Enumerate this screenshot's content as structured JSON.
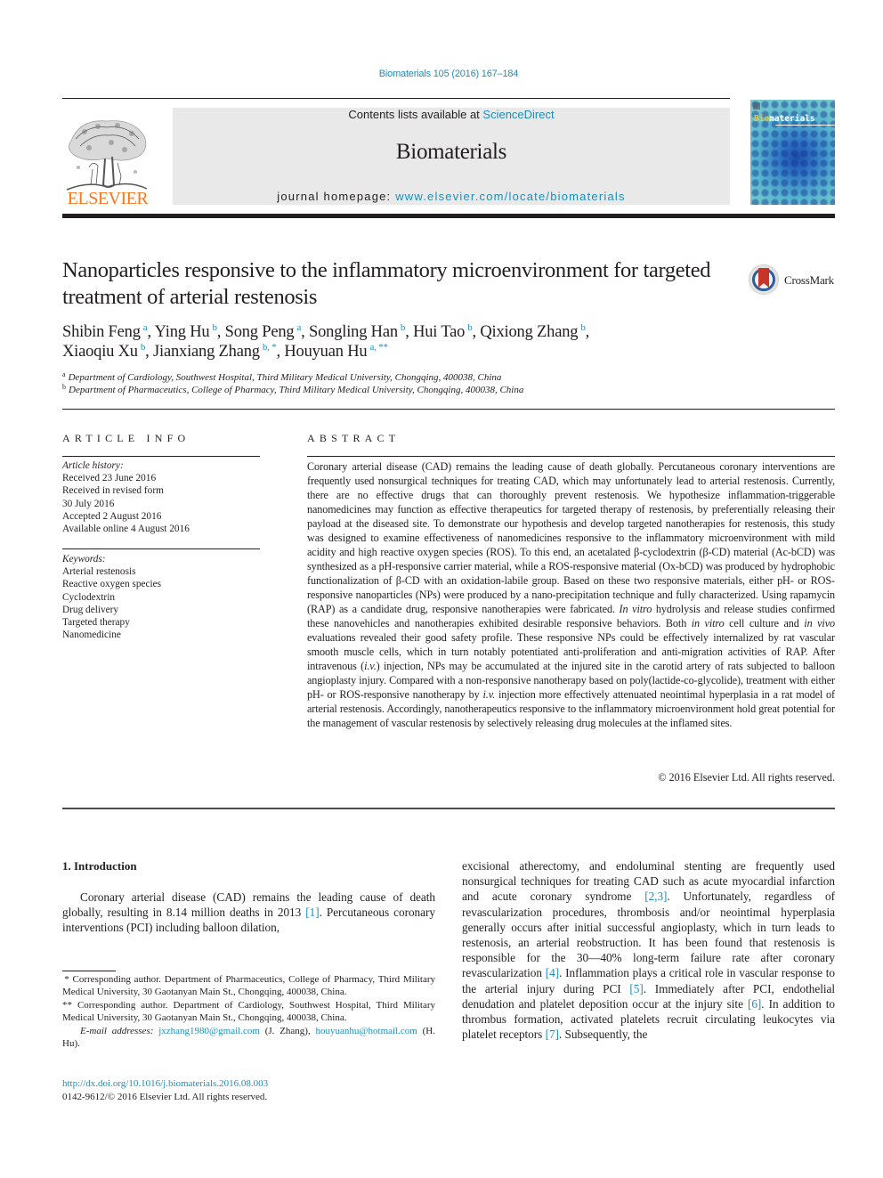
{
  "header": {
    "citation": "Biomaterials 105 (2016) 167–184",
    "contents_prefix": "Contents lists available at ",
    "contents_link": "ScienceDirect",
    "journal_name": "Biomaterials",
    "homepage_prefix": "journal homepage: ",
    "homepage_link": "www.elsevier.com/locate/biomaterials",
    "publisher_logo_text": "ELSEVIER",
    "cover_title_highlight": "Bio",
    "cover_title_rest": "materials",
    "crossmark_label": "CrossMark"
  },
  "article": {
    "title": "Nanoparticles responsive to the inflammatory microenvironment for targeted treatment of arterial restenosis",
    "authors": [
      {
        "name": "Shibin Feng",
        "aff": "a",
        "sep": ", "
      },
      {
        "name": "Ying Hu",
        "aff": "b",
        "sep": ", "
      },
      {
        "name": "Song Peng",
        "aff": "a",
        "sep": ", "
      },
      {
        "name": "Songling Han",
        "aff": "b",
        "sep": ", "
      },
      {
        "name": "Hui Tao",
        "aff": "b",
        "sep": ", "
      },
      {
        "name": "Qixiong Zhang",
        "aff": "b",
        "sep": ","
      },
      {
        "name": "Xiaoqiu Xu",
        "aff": "b",
        "sep": ", "
      },
      {
        "name": "Jianxiang Zhang",
        "aff": "b, *",
        "sep": ", "
      },
      {
        "name": "Houyuan Hu",
        "aff": "a, **",
        "sep": ""
      }
    ],
    "affiliations": [
      {
        "key": "a",
        "text": "Department of Cardiology, Southwest Hospital, Third Military Medical University, Chongqing, 400038, China"
      },
      {
        "key": "b",
        "text": "Department of Pharmaceutics, College of Pharmacy, Third Military Medical University, Chongqing, 400038, China"
      }
    ]
  },
  "article_info": {
    "heading": "ARTICLE INFO",
    "history_label": "Article history:",
    "history": [
      "Received 23 June 2016",
      "Received in revised form",
      "30 July 2016",
      "Accepted 2 August 2016",
      "Available online 4 August 2016"
    ],
    "keywords_label": "Keywords:",
    "keywords": [
      "Arterial restenosis",
      "Reactive oxygen species",
      "Cyclodextrin",
      "Drug delivery",
      "Targeted therapy",
      "Nanomedicine"
    ]
  },
  "abstract": {
    "heading": "ABSTRACT",
    "p1": "Coronary arterial disease (CAD) remains the leading cause of death globally. Percutaneous coronary interventions are frequently used nonsurgical techniques for treating CAD, which may unfortunately lead to arterial restenosis. Currently, there are no effective drugs that can thoroughly prevent restenosis. We hypothesize inflammation-triggerable nanomedicines may function as effective therapeutics for targeted therapy of restenosis, by preferentially releasing their payload at the diseased site. To demonstrate our hypothesis and develop targeted nanotherapies for restenosis, this study was designed to examine effectiveness of nanomedicines responsive to the inflammatory microenvironment with mild acidity and high reactive oxygen species (ROS). To this end, an acetalated β-cyclodextrin (β-CD) material (Ac-bCD) was synthesized as a pH-responsive carrier material, while a ROS-responsive material (Ox-bCD) was produced by hydrophobic functionalization of β-CD with an oxidation-labile group. Based on these two responsive materials, either pH- or ROS-responsive nanoparticles (NPs) were produced by a nano-precipitation technique and fully characterized. Using rapamycin (RAP) as a candidate drug, responsive nanotherapies were fabricated. ",
    "it1": "In vitro",
    "p2": " hydrolysis and release studies confirmed these nanovehicles and nanotherapies exhibited desirable responsive behaviors. Both ",
    "it2": "in vitro",
    "p3": " cell culture and ",
    "it3": "in vivo",
    "p4": " evaluations revealed their good safety profile. These responsive NPs could be effectively internalized by rat vascular smooth muscle cells, which in turn notably potentiated anti-proliferation and anti-migration activities of RAP. After intravenous (",
    "it4": "i.v.",
    "p5": ") injection, NPs may be accumulated at the injured site in the carotid artery of rats subjected to balloon angioplasty injury. Compared with a non-responsive nanotherapy based on poly(lactide-co-glycolide), treatment with either pH- or ROS-responsive nanotherapy by ",
    "it5": "i.v.",
    "p6": " injection more effectively attenuated neointimal hyperplasia in a rat model of arterial restenosis. Accordingly, nanotherapeutics responsive to the inflammatory microenvironment hold great potential for the management of vascular restenosis by selectively releasing drug molecules at the inflamed sites.",
    "copyright": "© 2016 Elsevier Ltd. All rights reserved."
  },
  "introduction": {
    "heading": "1.  Introduction",
    "left_a": "Coronary arterial disease (CAD) remains the leading cause of death globally, resulting in 8.14 million deaths in 2013 ",
    "ref1": "[1]",
    "left_b": ". Percutaneous coronary interventions (PCI) including balloon dilation,",
    "right_a": "excisional atherectomy, and endoluminal stenting are frequently used nonsurgical techniques for treating CAD such as acute myocardial infarction and acute coronary syndrome ",
    "ref23": "[2,3]",
    "right_b": ". Unfortunately, regardless of revascularization procedures, thrombosis and/or neointimal hyperplasia generally occurs after initial successful angioplasty, which in turn leads to restenosis, an arterial reobstruction. It has been found that restenosis is responsible for the 30—40% long-term failure rate after coronary revascularization ",
    "ref4": "[4]",
    "right_c": ". Inflammation plays a critical role in vascular response to the arterial injury during PCI ",
    "ref5": "[5]",
    "right_d": ". Immediately after PCI, endothelial denudation and platelet deposition occur at the injury site ",
    "ref6": "[6]",
    "right_e": ". In addition to thrombus formation, activated platelets recruit circulating leukocytes via platelet receptors ",
    "ref7": "[7]",
    "right_f": ". Subsequently, the"
  },
  "footnotes": {
    "fn1": " * Corresponding author. Department of Pharmaceutics, College of Pharmacy, Third Military Medical University, 30 Gaotanyan Main St., Chongqing, 400038, China.",
    "fn2": "** Corresponding author. Department of Cardiology, Southwest Hospital, Third Military Medical University, 30 Gaotanyan Main St., Chongqing, 400038, China.",
    "email_label": "E-mail addresses:",
    "email1": "jxzhang1980@gmail.com",
    "email1_owner": " (J. Zhang), ",
    "email2": "houyuanhu@hotmail.com",
    "email2_owner": " (H. Hu).",
    "doi": "http://dx.doi.org/10.1016/j.biomaterials.2016.08.003",
    "issn": "0142-9612/© 2016 Elsevier Ltd. All rights reserved."
  },
  "colors": {
    "link": "#1a8fbf",
    "elsevier_orange": "#f47920",
    "text": "#231f20",
    "masthead_bg": "#e9e9e9"
  }
}
